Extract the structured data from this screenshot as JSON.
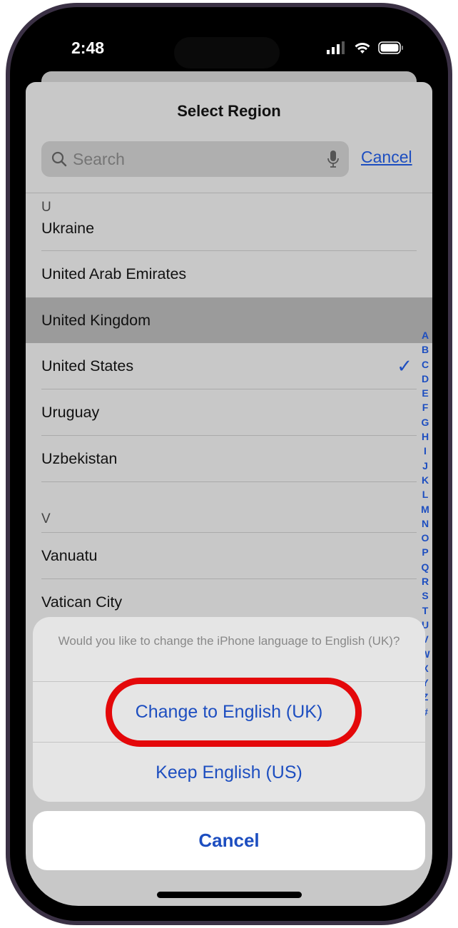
{
  "status_bar": {
    "time": "2:48",
    "signal_icon": "cellular-signal-icon",
    "wifi_icon": "wifi-icon",
    "battery_icon": "battery-icon"
  },
  "sheet": {
    "title": "Select Region",
    "search": {
      "placeholder": "Search",
      "value": "",
      "icon": "search-icon",
      "mic_icon": "microphone-icon"
    },
    "cancel_label": "Cancel",
    "sections": [
      {
        "header": "U",
        "items": [
          {
            "label": "Ukraine"
          },
          {
            "label": "United Arab Emirates"
          },
          {
            "label": "United Kingdom",
            "highlighted": true
          },
          {
            "label": "United States",
            "checked": true
          },
          {
            "label": "Uruguay"
          },
          {
            "label": "Uzbekistan"
          }
        ]
      },
      {
        "header": "V",
        "items": [
          {
            "label": "Vanuatu"
          },
          {
            "label": "Vatican City"
          }
        ]
      }
    ],
    "index": [
      "A",
      "B",
      "C",
      "D",
      "E",
      "F",
      "G",
      "H",
      "I",
      "J",
      "K",
      "L",
      "M",
      "N",
      "O",
      "P",
      "Q",
      "R",
      "S",
      "T",
      "U",
      "V",
      "W",
      "X",
      "Y",
      "Z",
      "#"
    ]
  },
  "action_sheet": {
    "message": "Would you like to change the iPhone language to English (UK)?",
    "primary": "Change to English (UK)",
    "secondary": "Keep English (US)",
    "cancel": "Cancel"
  },
  "colors": {
    "accent": "#1d4ec0",
    "annotation": "#e4080a",
    "highlight": "#9b9b9b"
  }
}
